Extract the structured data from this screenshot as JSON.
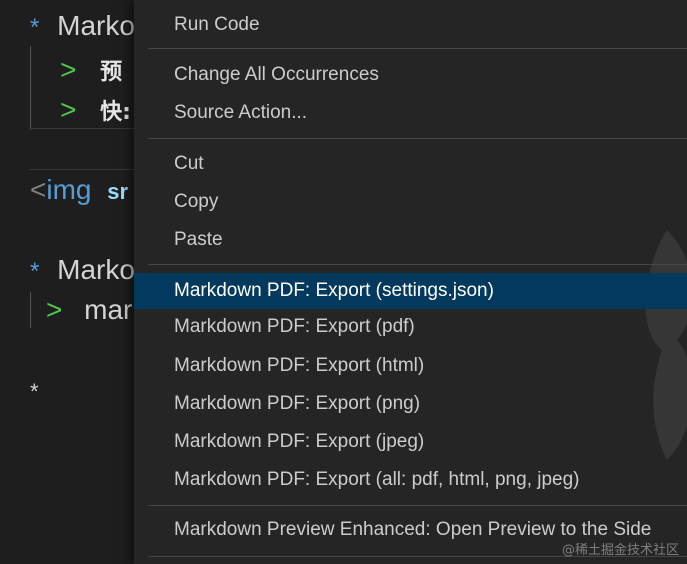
{
  "editor": {
    "line1": {
      "bullet": "*",
      "text": "Marko"
    },
    "line2": {
      "quote": ">",
      "text": "预"
    },
    "line3": {
      "quote": ">",
      "text": "快:"
    },
    "line4": {
      "bracket": "<",
      "tag": "img",
      "attr": "sr"
    },
    "line5": {
      "bullet": "*",
      "text": "Marko"
    },
    "line6": {
      "quote": ">",
      "text": "mar"
    },
    "line7": {
      "bullet": "*"
    }
  },
  "menu": {
    "run_code": "Run Code",
    "change_all": "Change All Occurrences",
    "source_action": "Source Action...",
    "cut": "Cut",
    "copy": "Copy",
    "paste": "Paste",
    "export_settings": "Markdown PDF: Export (settings.json)",
    "export_pdf": "Markdown PDF: Export (pdf)",
    "export_html": "Markdown PDF: Export (html)",
    "export_png": "Markdown PDF: Export (png)",
    "export_jpeg": "Markdown PDF: Export (jpeg)",
    "export_all": "Markdown PDF: Export (all: pdf, html, png, jpeg)",
    "preview_side": "Markdown Preview Enhanced: Open Preview to the Side"
  },
  "watermark": "@稀土掘金技术社区",
  "colors": {
    "editor_bg": "#1e1e1e",
    "menu_bg": "#252526",
    "highlight": "#04395e",
    "bullet": "#569cd6",
    "quote": "#4ec94e"
  }
}
